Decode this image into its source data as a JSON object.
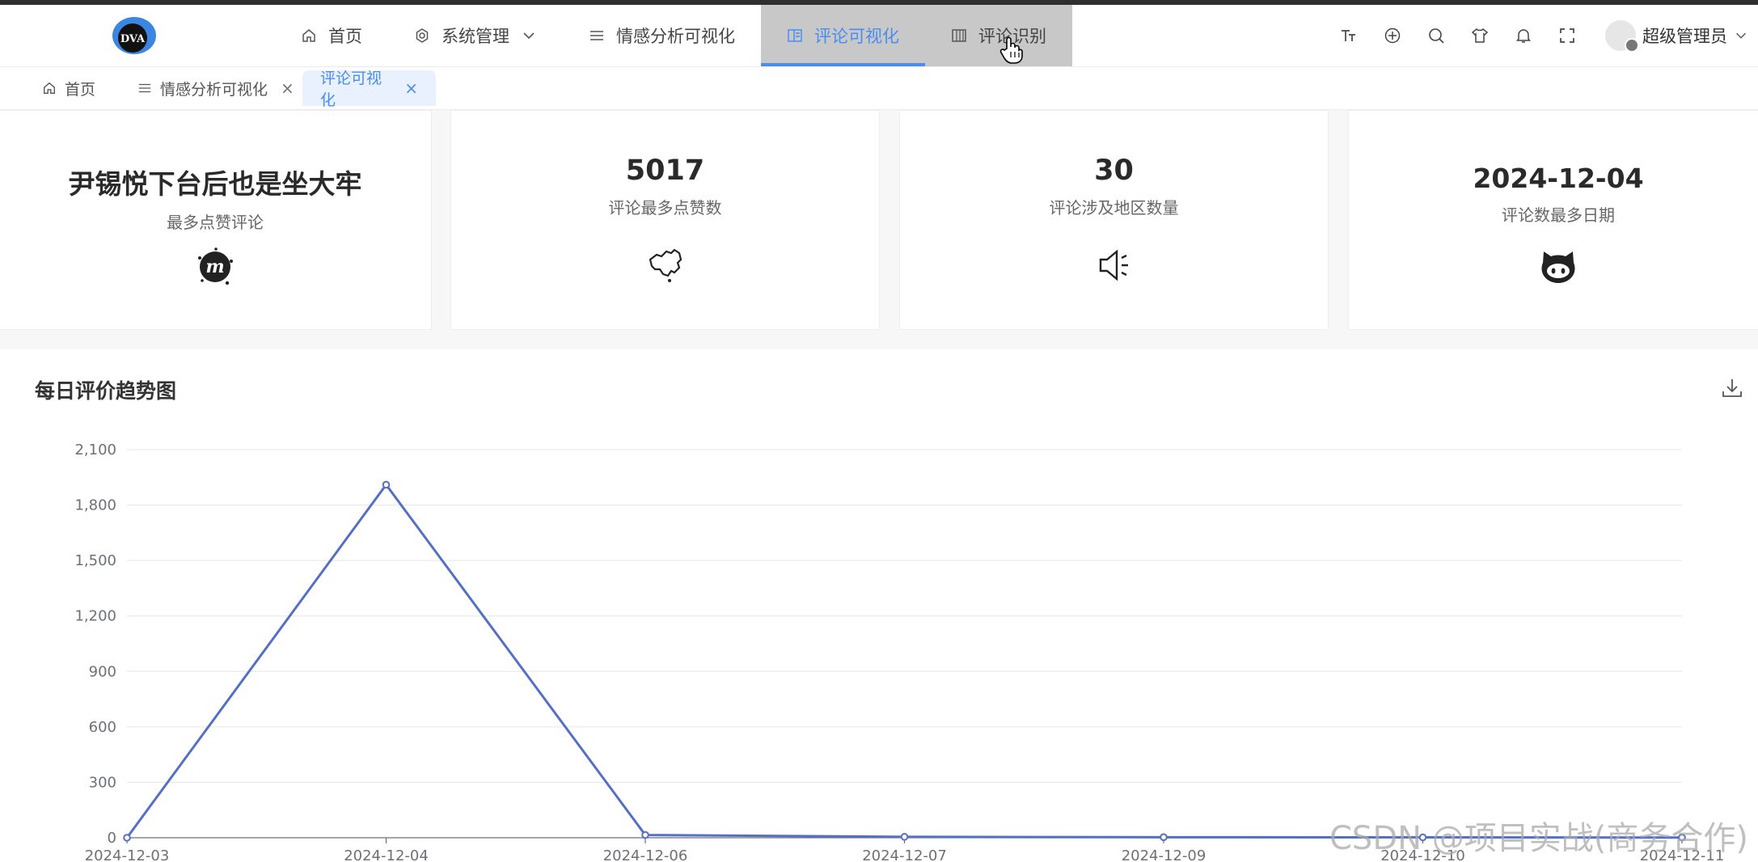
{
  "header": {
    "logo_text": "DVA",
    "nav": [
      {
        "label": "首页",
        "icon": "home-icon"
      },
      {
        "label": "系统管理",
        "icon": "gear-icon",
        "has_dropdown": true
      },
      {
        "label": "情感分析可视化",
        "icon": "menu-lines-icon"
      },
      {
        "label": "评论可视化",
        "icon": "layout-icon",
        "active": true
      },
      {
        "label": "评论识别",
        "icon": "columns-icon"
      }
    ],
    "tools": [
      "font-size-icon",
      "globe-icon",
      "search-icon",
      "shirt-icon",
      "bell-icon",
      "fullscreen-icon"
    ],
    "user_name": "超级管理员"
  },
  "tabs": [
    {
      "label": "首页",
      "icon": "home-icon",
      "closable": false
    },
    {
      "label": "情感分析可视化",
      "icon": "menu-lines-icon",
      "closable": true
    },
    {
      "label": "评论可视化",
      "closable": true,
      "active": true
    }
  ],
  "close_glyph": "×",
  "cards": [
    {
      "value": "尹锡悦下台后也是坐大牢",
      "label": "最多点赞评论",
      "icon": "meetup-icon"
    },
    {
      "value": "5017",
      "label": "评论最多点赞数",
      "icon": "china-map-icon"
    },
    {
      "value": "30",
      "label": "评论涉及地区数量",
      "icon": "speaker-icon"
    },
    {
      "value": "2024-12-04",
      "label": "评论数最多日期",
      "icon": "github-cat-icon"
    }
  ],
  "chart_title": "每日评价趋势图",
  "chart_data": {
    "type": "line",
    "title": "每日评价趋势图",
    "categories": [
      "2024-12-03",
      "2024-12-04",
      "2024-12-06",
      "2024-12-07",
      "2024-12-09",
      "2024-12-10",
      "2024-12-11"
    ],
    "values": [
      0,
      1910,
      15,
      5,
      3,
      2,
      1
    ],
    "y_ticks": [
      "0",
      "300",
      "600",
      "900",
      "1,200",
      "1,500",
      "1,800",
      "2,100"
    ],
    "ylim": [
      0,
      2100
    ],
    "grid": true,
    "color": "#5470c6"
  },
  "watermark": "CSDN @项目实战(商务合作)"
}
